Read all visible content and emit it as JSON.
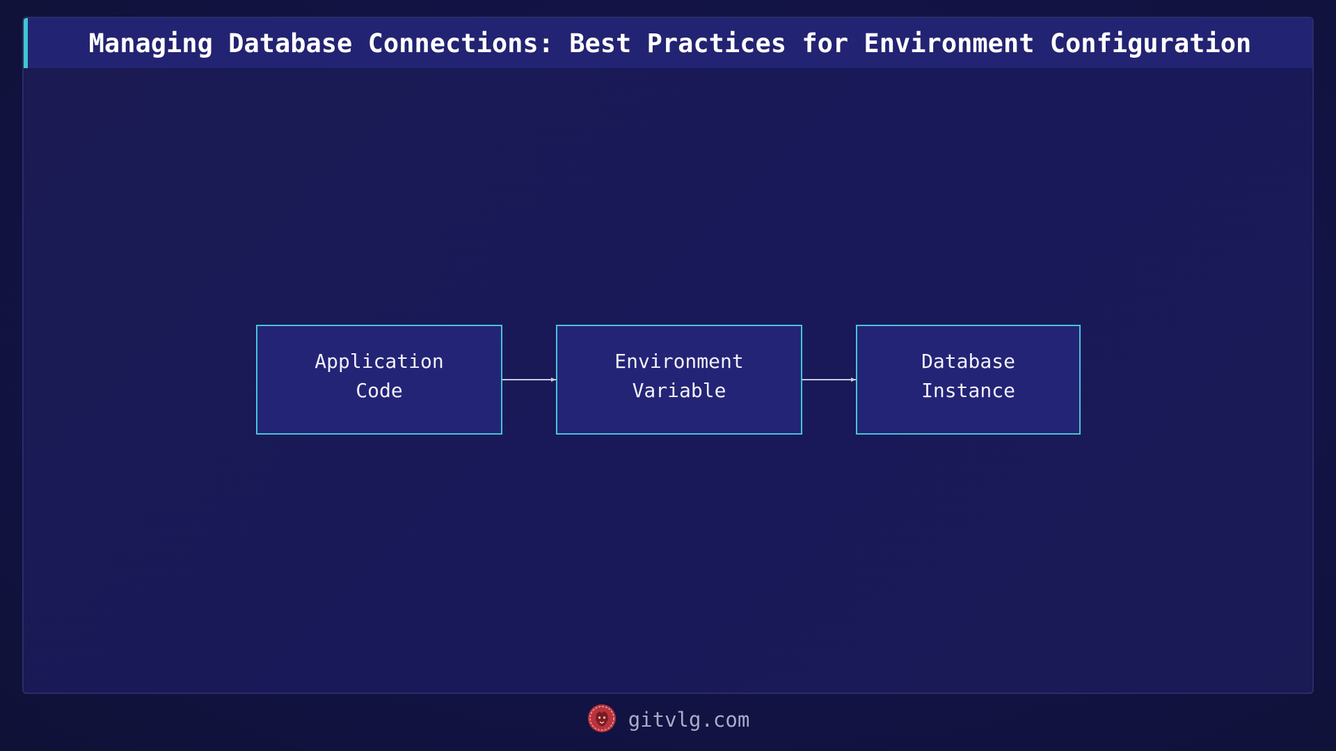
{
  "header": {
    "title": "Managing Database Connections: Best Practices for Environment Configuration"
  },
  "diagram": {
    "nodes": [
      {
        "id": "app",
        "label": "Application\nCode"
      },
      {
        "id": "env",
        "label": "Environment\nVariable"
      },
      {
        "id": "db",
        "label": "Database\nInstance"
      }
    ],
    "edges": [
      {
        "from": "app",
        "to": "env"
      },
      {
        "from": "env",
        "to": "db"
      }
    ]
  },
  "footer": {
    "site": "gitvlg.com",
    "logo_icon": "lion-logo-icon"
  },
  "colors": {
    "background": "#15154a",
    "title_bar": "#232373",
    "accent": "#3fc7d0",
    "node_fill": "#242477",
    "node_border": "#48c6d6",
    "arrow": "#c8cde0",
    "logo": "#e0444b"
  }
}
